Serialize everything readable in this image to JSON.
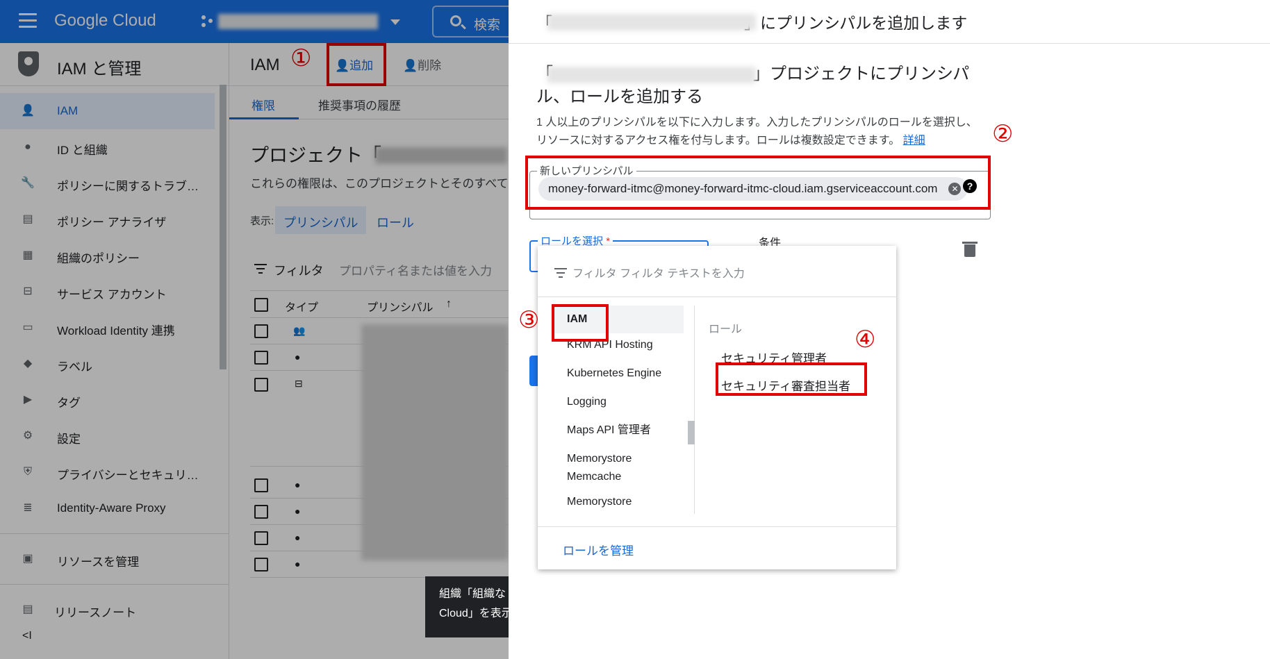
{
  "topbar": {
    "logo": "Google Cloud",
    "search_label": "検索"
  },
  "sidebar": {
    "title": "IAM と管理",
    "items": [
      {
        "label": "IAM",
        "icon": "add-person-icon"
      },
      {
        "label": "ID と組織",
        "icon": "account-circle-icon"
      },
      {
        "label": "ポリシーに関するトラブ…",
        "icon": "wrench-icon"
      },
      {
        "label": "ポリシー アナライザ",
        "icon": "policy-analyzer-icon"
      },
      {
        "label": "組織のポリシー",
        "icon": "list-icon"
      },
      {
        "label": "サービス アカウント",
        "icon": "service-account-icon"
      },
      {
        "label": "Workload Identity 連携",
        "icon": "id-card-icon"
      },
      {
        "label": "ラベル",
        "icon": "tag-icon"
      },
      {
        "label": "タグ",
        "icon": "chevron-tag-icon"
      },
      {
        "label": "設定",
        "icon": "gear-icon"
      },
      {
        "label": "プライバシーとセキュリ…",
        "icon": "shield-icon"
      },
      {
        "label": "Identity-Aware Proxy",
        "icon": "proxy-icon"
      }
    ],
    "footer_items": [
      {
        "label": "リソースを管理",
        "icon": "folder-gear-icon"
      },
      {
        "label": "リリースノート",
        "icon": "notes-icon"
      }
    ],
    "collapse": "<I"
  },
  "main": {
    "title": "IAM",
    "annotation_1": "①",
    "add_label": "追加",
    "delete_label": "削除",
    "tabs": [
      "権限",
      "推奨事項の履歴"
    ],
    "project_heading": "プロジェクト「",
    "description": "これらの権限は、このプロジェクトとそのすべて",
    "view_label": "表示:",
    "view_principal": "プリンシパル",
    "view_role": "ロール",
    "filter_label": "フィルタ",
    "filter_placeholder": "プロパティ名または値を入力",
    "col_type": "タイプ",
    "col_principal": "プリンシパル"
  },
  "toast": {
    "line1": "組織「組織な",
    "line2": "Cloud」を表示"
  },
  "panel": {
    "title": "「　　　　　　　　　　　　」にプリンシパルを追加します",
    "heading": "「　　　　　　　　　　　　」プロジェクトにプリンシパル、ロールを追加する",
    "description": "1 人以上のプリンシパルを以下に入力します。入力したプリンシパルのロールを選択し、リソースに対するアクセス権を付与します。ロールは複数設定できます。",
    "details_link": "詳細",
    "annotation_2": "②",
    "principal_label": "新しいプリンシパル",
    "principal_value": "money-forward-itmc@money-forward-itmc-cloud.iam.gserviceaccount.com",
    "role_label": "ロールを選択",
    "required_mark": "*",
    "condition_label": "条件",
    "dropdown": {
      "filter_text": "フィルタ フィルタ テキストを入力",
      "annotation_3": "③",
      "annotation_4": "④",
      "services": [
        "IAM",
        "KRM API Hosting",
        "Kubernetes Engine",
        "Logging",
        "Maps API 管理者",
        "Memorystore Memcache",
        "Memorystore"
      ],
      "roles_header": "ロール",
      "roles": [
        "セキュリティ管理者",
        "セキュリティ審査担当者"
      ],
      "manage_roles": "ロールを管理"
    }
  }
}
